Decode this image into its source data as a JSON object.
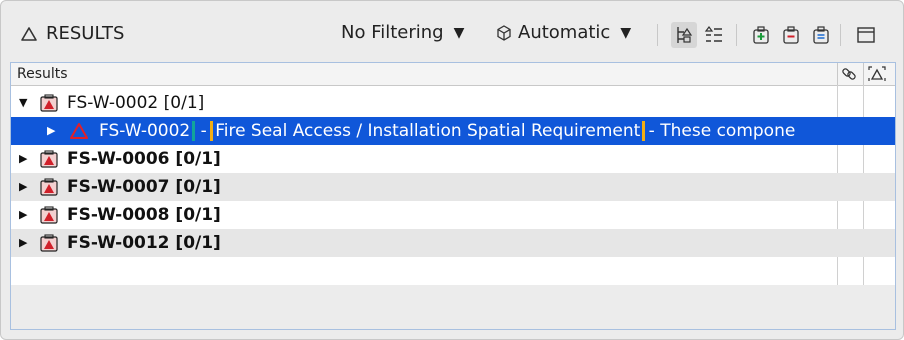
{
  "panel": {
    "title": "RESULTS"
  },
  "toolbar": {
    "filter_label": "No Filtering",
    "mode_label": "Automatic"
  },
  "table": {
    "column_header": "Results"
  },
  "rows": [
    {
      "label": "FS-W-0002 [0/1]",
      "expanded": true
    },
    {
      "id": "FS-W-0002",
      "sep1": " - ",
      "title": "Fire Seal Access / Installation Spatial Requirement",
      "sep2": " - ",
      "desc": "These compone"
    },
    {
      "label": "FS-W-0006 [0/1]"
    },
    {
      "label": "FS-W-0007 [0/1]"
    },
    {
      "label": "FS-W-0008 [0/1]"
    },
    {
      "label": "FS-W-0012 [0/1]"
    }
  ],
  "colors": {
    "selection": "#1057d9",
    "teal": "#11a59a",
    "orange": "#f2ae14",
    "issue_red": "#d0202a"
  }
}
